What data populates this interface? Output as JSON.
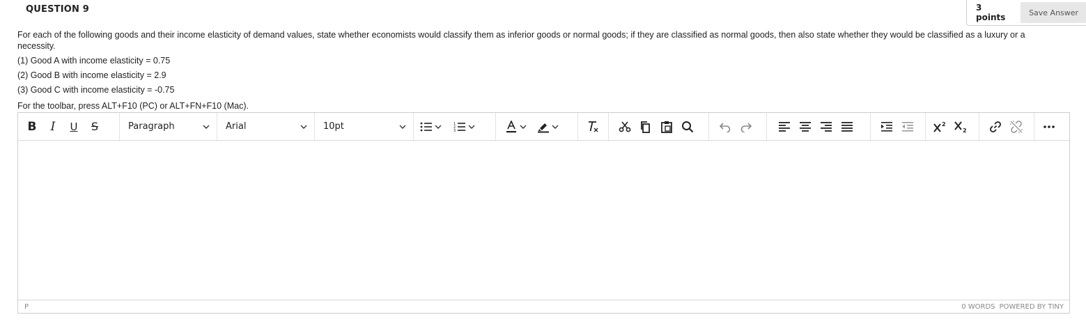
{
  "header": {
    "question_title": "QUESTION 9",
    "points": "3 points",
    "save_label": "Save Answer"
  },
  "question": {
    "prompt": "For each of the following goods and their income elasticity of demand values, state whether economists would classify them as inferior goods or normal goods; if they are classified as normal goods, then also state whether they would be classified as a luxury or a necessity.",
    "items": [
      "(1) Good A with income elasticity = 0.75",
      "(2) Good B with income elasticity = 2.9",
      "(3) Good C with income elasticity = -0.75"
    ],
    "toolbar_hint": "For the toolbar, press ALT+F10 (PC) or ALT+FN+F10 (Mac)."
  },
  "toolbar": {
    "block_format": "Paragraph",
    "font_family": "Arial",
    "font_size": "10pt",
    "buttons": {
      "bold": "B",
      "italic": "I",
      "underline": "U",
      "strikethrough": "S"
    },
    "icons": [
      "bold-icon",
      "italic-icon",
      "underline-icon",
      "strikethrough-icon",
      "bullet-list-icon",
      "numbered-list-icon",
      "text-color-icon",
      "highlight-icon",
      "clear-formatting-icon",
      "cut-icon",
      "copy-icon",
      "paste-icon",
      "search-icon",
      "undo-icon",
      "redo-icon",
      "align-left-icon",
      "align-center-icon",
      "align-right-icon",
      "justify-icon",
      "indent-icon",
      "outdent-icon",
      "superscript-icon",
      "subscript-icon",
      "link-icon",
      "unlink-icon",
      "more-icon"
    ],
    "accent_color": "#222222"
  },
  "editor": {
    "content": ""
  },
  "statusbar": {
    "path": "P",
    "word_count": "0 WORDS",
    "powered_by": "POWERED BY TINY"
  }
}
